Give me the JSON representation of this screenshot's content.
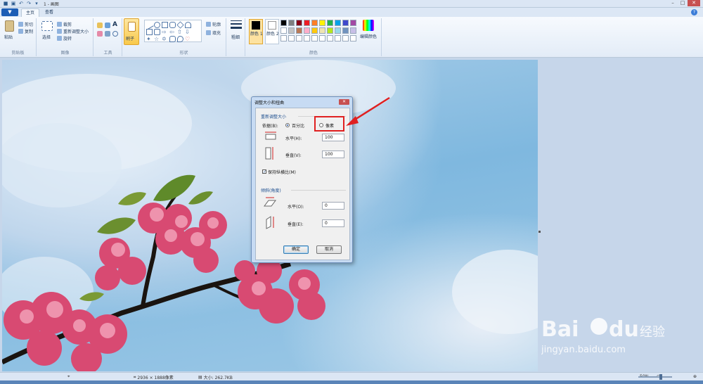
{
  "window": {
    "title": "1 - 画图",
    "quick_access": [
      "save-icon",
      "undo-icon",
      "redo-icon"
    ]
  },
  "tabs": {
    "file_label": "▼",
    "items": [
      "主页",
      "查看"
    ]
  },
  "ribbon": {
    "clipboard": {
      "paste_label": "粘贴",
      "cut_label": "剪切",
      "copy_label": "复制",
      "group_label": "剪贴板"
    },
    "image": {
      "select_label": "选择",
      "crop_label": "裁剪",
      "resize_label": "重新调整大小",
      "rotate_label": "旋转",
      "group_label": "图像"
    },
    "tools": {
      "group_label": "工具"
    },
    "brush": {
      "label": "刷子"
    },
    "shapes": {
      "outline_label": "轮廓",
      "fill_label": "填充",
      "group_label": "形状"
    },
    "size": {
      "label": "粗细"
    },
    "colors": {
      "color1_label": "颜色 1",
      "color2_label": "颜色 2",
      "edit_label": "编辑颜色",
      "group_label": "颜色",
      "palette_row1": [
        "#000000",
        "#7f7f7f",
        "#880015",
        "#ed1c24",
        "#ff7f27",
        "#fff200",
        "#22b14c",
        "#00a2e8",
        "#3f48cc",
        "#a349a4"
      ],
      "palette_row2": [
        "#ffffff",
        "#c3c3c3",
        "#b97a57",
        "#ffaec9",
        "#ffc90e",
        "#efe4b0",
        "#b5e61d",
        "#99d9ea",
        "#7092be",
        "#c8bfe7"
      ]
    }
  },
  "dialog": {
    "title": "调整大小和扭曲",
    "resize_section": "重新调整大小",
    "by_label": "依据(B):",
    "percent_label": "百分比",
    "pixel_label": "像素",
    "horizontal_label": "水平(H):",
    "horizontal_value": "100",
    "vertical_label": "垂直(V):",
    "vertical_value": "100",
    "keep_ratio_label": "保持纵横比(M)",
    "skew_section": "倾斜(角度)",
    "skew_h_label": "水平(O):",
    "skew_h_value": "0",
    "skew_v_label": "垂直(E):",
    "skew_v_value": "0",
    "ok_label": "确定",
    "cancel_label": "取消"
  },
  "statusbar": {
    "dimensions": "2936 × 1888像素",
    "size": "大小: 262.7KB",
    "zoom": "50%"
  },
  "watermark": {
    "text": "Baidu经验 jingyan.baidu.com"
  }
}
